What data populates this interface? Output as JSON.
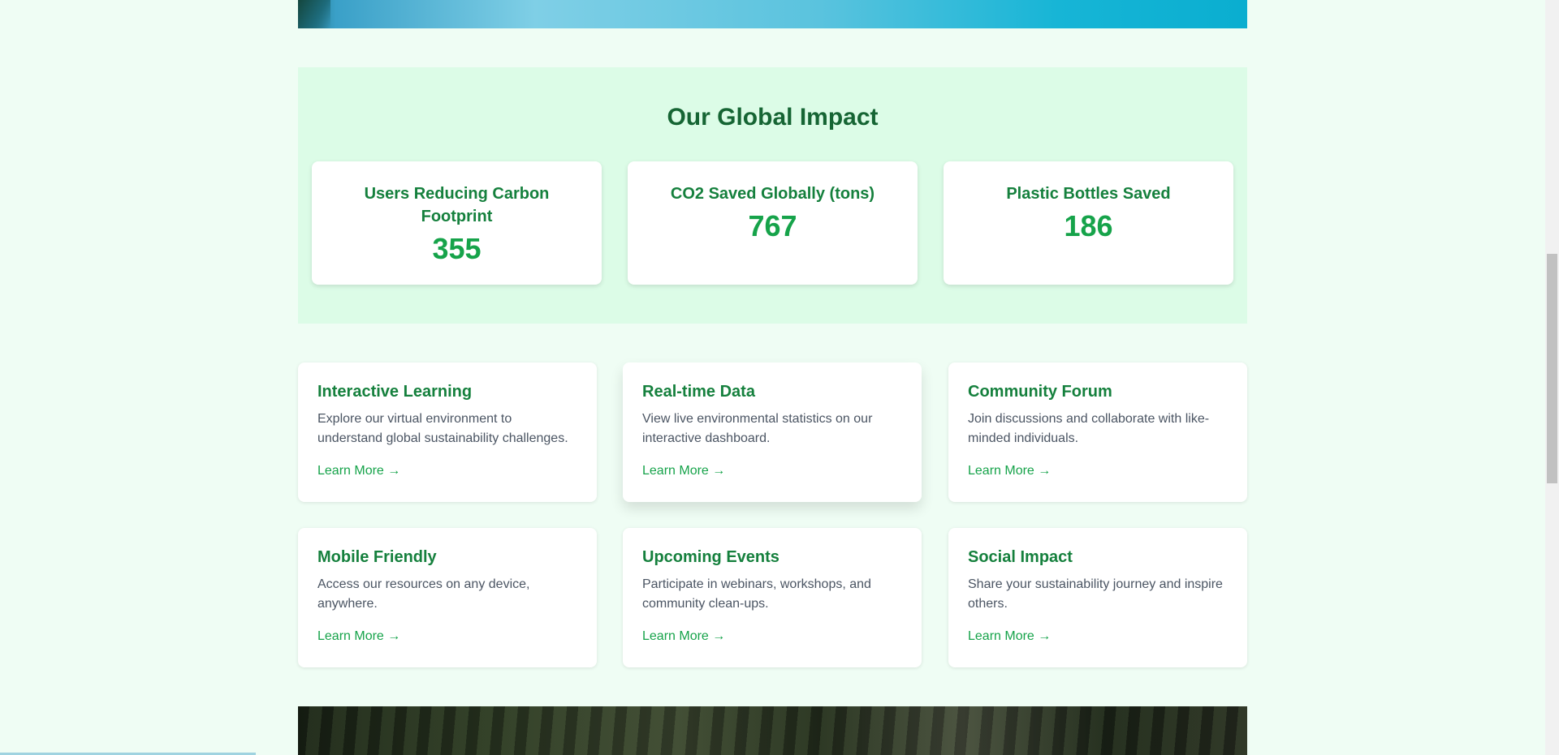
{
  "impact": {
    "title": "Our Global Impact",
    "stats": [
      {
        "label": "Users Reducing Carbon Footprint",
        "value": "355"
      },
      {
        "label": "CO2 Saved Globally (tons)",
        "value": "767"
      },
      {
        "label": "Plastic Bottles Saved",
        "value": "186"
      }
    ]
  },
  "features": [
    {
      "title": "Interactive Learning",
      "description": "Explore our virtual environment to understand global sustainability challenges.",
      "link": "Learn More →"
    },
    {
      "title": "Real-time Data",
      "description": "View live environmental statistics on our interactive dashboard.",
      "link": "Learn More →"
    },
    {
      "title": "Community Forum",
      "description": "Join discussions and collaborate with like-minded individuals.",
      "link": "Learn More →"
    },
    {
      "title": "Mobile Friendly",
      "description": "Access our resources on any device, anywhere.",
      "link": "Learn More →"
    },
    {
      "title": "Upcoming Events",
      "description": "Participate in webinars, workshops, and community clean-ups.",
      "link": "Learn More →"
    },
    {
      "title": "Social Impact",
      "description": "Share your sustainability journey and inspire others.",
      "link": "Learn More →"
    }
  ],
  "colors": {
    "page_bg": "#effdf4",
    "impact_bg": "#dcfce7",
    "heading": "#166534",
    "accent": "#16a34a",
    "text": "#4b5563"
  }
}
